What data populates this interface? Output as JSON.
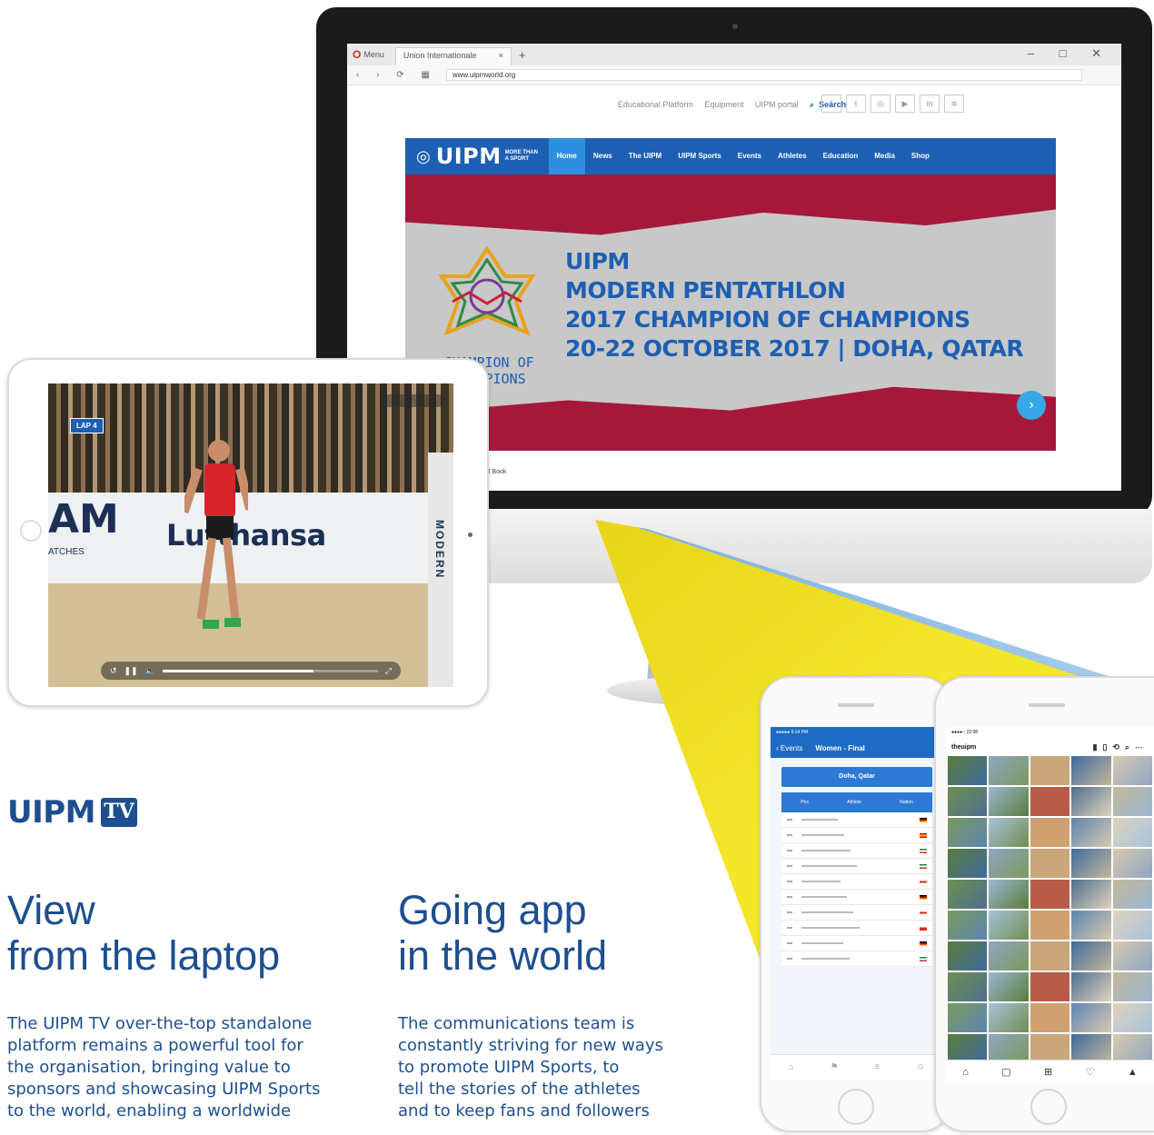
{
  "browser": {
    "menu_label": "Menu",
    "tab_title": "Union Internationale",
    "url": "www.uipmworld.org"
  },
  "website": {
    "top_links": [
      "Educational Platform",
      "Equipment",
      "UIPM portal",
      "Search"
    ],
    "logo": "UIPM",
    "logo_tagline": "MORE THAN A SPORT",
    "nav_items": [
      "Home",
      "News",
      "The UIPM",
      "UIPM Sports",
      "Events",
      "Athletes",
      "Education",
      "Media",
      "Shop"
    ],
    "active_nav": "Home",
    "banner": {
      "logo_text_line1": "CHAMPION OF",
      "logo_text_line2": "CHAMPIONS",
      "headline_lines": [
        "UIPM",
        "MODERN PENTATHLON",
        "2017 CHAMPION OF CHAMPIONS",
        "20-22 OCTOBER 2017 | DOHA, QATAR"
      ]
    },
    "below_banner_items": [
      "UIPM Book"
    ]
  },
  "tablet": {
    "badge": "LAP 4",
    "wall_text": "Lufthansa",
    "wall_left_text": "AM",
    "wall_small_text": "ATCHES",
    "pole_text": "MODERN",
    "progress_fraction": 0.7
  },
  "phone_left": {
    "nav_back": "Events",
    "nav_title": "Women - Final",
    "card_title": "Doha, Qatar",
    "table_columns": [
      "Pos",
      "Athlete",
      "Nation"
    ],
    "rows_visible": 10
  },
  "phone_right": {
    "profile_name": "theuipm"
  },
  "article": {
    "logo_word": "UIPM",
    "logo_box": "TV",
    "left_heading_line1": "View",
    "left_heading_line2": "from the laptop",
    "left_body": [
      "The UIPM TV over-the-top standalone",
      "platform remains a powerful tool for",
      "the organisation, bringing value to",
      "sponsors and showcasing UIPM Sports",
      "to the world, enabling a worldwide"
    ],
    "right_heading_line1": "Going app",
    "right_heading_line2": "in the world",
    "right_body": [
      "The communications team is",
      "constantly striving for new ways",
      "to promote UIPM Sports, to",
      "tell the stories of the athletes",
      "and to keep fans and followers"
    ]
  },
  "colors": {
    "brand_blue": "#1d4f8f",
    "site_nav_blue": "#1d5fb3",
    "banner_red": "#a6183a",
    "beam_yellow": "#f2e21a"
  }
}
